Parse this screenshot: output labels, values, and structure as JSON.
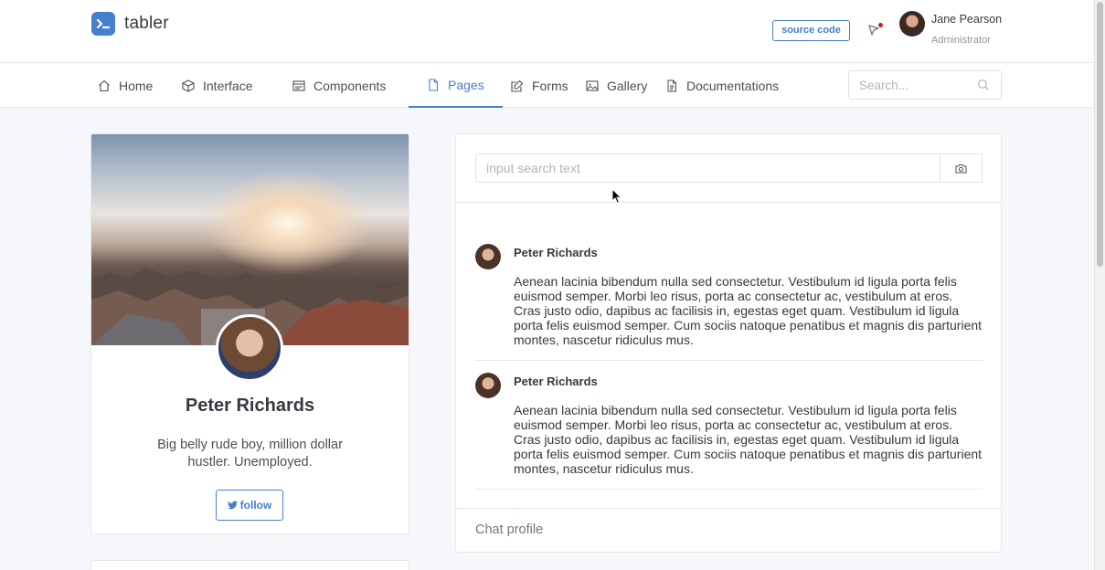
{
  "header": {
    "brand_name": "tabler",
    "source_code_label": "source code",
    "user": {
      "name": "Jane Pearson",
      "role": "Administrator"
    }
  },
  "nav": {
    "items": [
      {
        "label": "Home",
        "icon": "home-icon"
      },
      {
        "label": "Interface",
        "icon": "box-icon"
      },
      {
        "label": "Components",
        "icon": "calendar-icon"
      },
      {
        "label": "Pages",
        "icon": "file-icon",
        "active": true
      },
      {
        "label": "Forms",
        "icon": "edit-icon"
      },
      {
        "label": "Gallery",
        "icon": "image-icon"
      },
      {
        "label": "Documentations",
        "icon": "file-text-icon"
      }
    ],
    "search_placeholder": "Search..."
  },
  "profile": {
    "name": "Peter Richards",
    "bio": "Big belly rude boy, million dollar hustler. Unemployed.",
    "follow_label": "follow"
  },
  "chat": {
    "search_placeholder": "input search text",
    "messages": [
      {
        "author": "Peter Richards",
        "text": "Aenean lacinia bibendum nulla sed consectetur. Vestibulum id ligula porta felis euismod semper. Morbi leo risus, porta ac consectetur ac, vestibulum at eros. Cras justo odio, dapibus ac facilisis in, egestas eget quam. Vestibulum id ligula porta felis euismod semper. Cum sociis natoque penatibus et magnis dis parturient montes, nascetur ridiculus mus."
      },
      {
        "author": "Peter Richards",
        "text": "Aenean lacinia bibendum nulla sed consectetur. Vestibulum id ligula porta felis euismod semper. Morbi leo risus, porta ac consectetur ac, vestibulum at eros. Cras justo odio, dapibus ac facilisis in, egestas eget quam. Vestibulum id ligula porta felis euismod semper. Cum sociis natoque penatibus et magnis dis parturient montes, nascetur ridiculus mus."
      }
    ],
    "footer_label": "Chat profile"
  },
  "colors": {
    "accent": "#467fcf",
    "background": "#f5f7fb",
    "notification": "#cd201f"
  }
}
